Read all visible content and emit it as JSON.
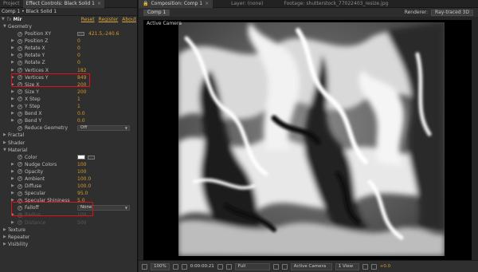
{
  "left_panel": {
    "tabs": [
      {
        "label": "Project"
      },
      {
        "label": "Effect Controls: Black Solid 1"
      }
    ],
    "close_glyph": "×",
    "breadcrumb": "Comp 1 • Black Solid 1",
    "effect": {
      "fx": "fx",
      "name": "Mir",
      "reset": "Reset",
      "register": "Register",
      "about": "About"
    },
    "rows": [
      {
        "indent": 0,
        "twirl": "▼",
        "label": "Geometry"
      },
      {
        "indent": 1,
        "stopwatch": true,
        "label": "Position XY",
        "crosshair": true,
        "value": "421.5,-240.6"
      },
      {
        "indent": 1,
        "twirl": "▶",
        "stopwatch": true,
        "label": "Position Z",
        "value": "0"
      },
      {
        "indent": 1,
        "twirl": "▶",
        "stopwatch": true,
        "label": "Rotate X",
        "value": "0"
      },
      {
        "indent": 1,
        "twirl": "▶",
        "stopwatch": true,
        "label": "Rotate Y",
        "value": "0"
      },
      {
        "indent": 1,
        "twirl": "▶",
        "stopwatch": true,
        "label": "Rotate Z",
        "value": "0"
      },
      {
        "indent": 1,
        "twirl": "▶",
        "stopwatch": true,
        "label": "Vertices X",
        "value": "182"
      },
      {
        "indent": 1,
        "twirl": "▶",
        "stopwatch": true,
        "label": "Vertices Y",
        "value": "849"
      },
      {
        "indent": 1,
        "twirl": "▶",
        "stopwatch": true,
        "label": "Size X",
        "value": "200"
      },
      {
        "indent": 1,
        "twirl": "▶",
        "stopwatch": true,
        "label": "Size Y",
        "value": "200"
      },
      {
        "indent": 1,
        "twirl": "▶",
        "stopwatch": true,
        "label": "X Step",
        "value": "1"
      },
      {
        "indent": 1,
        "twirl": "▶",
        "stopwatch": true,
        "label": "Y Step",
        "value": "1"
      },
      {
        "indent": 1,
        "twirl": "▶",
        "stopwatch": true,
        "label": "Bend X",
        "value": "0.0"
      },
      {
        "indent": 1,
        "twirl": "▶",
        "stopwatch": true,
        "label": "Bend Y",
        "value": "0.0"
      },
      {
        "indent": 1,
        "stopwatch": true,
        "label": "Reduce Geometry",
        "dropdown": "Off"
      },
      {
        "indent": 0,
        "twirl": "▶",
        "label": "Fractal"
      },
      {
        "indent": 0,
        "twirl": "▶",
        "label": "Shader"
      },
      {
        "indent": 0,
        "twirl": "▼",
        "label": "Material"
      },
      {
        "indent": 1,
        "stopwatch": true,
        "label": "Color",
        "swatch": true
      },
      {
        "indent": 1,
        "twirl": "▶",
        "stopwatch": true,
        "label": "Nudge Colors",
        "value": "100"
      },
      {
        "indent": 1,
        "twirl": "▶",
        "stopwatch": true,
        "label": "Opacity",
        "value": "100"
      },
      {
        "indent": 1,
        "twirl": "▶",
        "stopwatch": true,
        "label": "Ambient",
        "value": "100.0"
      },
      {
        "indent": 1,
        "twirl": "▶",
        "stopwatch": true,
        "label": "Diffuse",
        "value": "100.0"
      },
      {
        "indent": 1,
        "twirl": "▶",
        "stopwatch": true,
        "label": "Specular",
        "value": "95.0"
      },
      {
        "indent": 1,
        "twirl": "▶",
        "stopwatch": true,
        "label": "Specular Shininess",
        "value": "5.0"
      },
      {
        "indent": 1,
        "stopwatch": true,
        "label": "Falloff",
        "dropdown": "None"
      },
      {
        "indent": 1,
        "twirl": "▶",
        "stopwatch": true,
        "label": "Radius",
        "value": "100",
        "dim": true
      },
      {
        "indent": 1,
        "twirl": "▶",
        "stopwatch": true,
        "label": "Distance",
        "value": "500",
        "dim": true
      },
      {
        "indent": 0,
        "twirl": "▶",
        "label": "Texture"
      },
      {
        "indent": 0,
        "twirl": "▶",
        "label": "Repeater"
      },
      {
        "indent": 0,
        "twirl": "▶",
        "label": "Visibility"
      }
    ]
  },
  "right_panel": {
    "tabs": [
      {
        "label": "Composition: Comp 1",
        "active": true
      },
      {
        "label": "Layer: (none)"
      },
      {
        "label": "Footage: shutterstock_77022403_resize.jpg"
      }
    ],
    "lock_glyph": "🔒",
    "comp_pill": "Comp 1",
    "renderer_label": "Renderer:",
    "renderer_value": "Ray-traced 3D",
    "viewer_label": "Active Camera",
    "bottom": {
      "zoom": "100%",
      "timecode": "0:00:00:21",
      "resolution": "Full",
      "camera": "Active Camera",
      "views": "1 View",
      "exposure": "+0.0"
    }
  },
  "colors": {
    "accent_value": "#d49a2a",
    "highlight_box": "#e0111a",
    "link": "#d8a640"
  }
}
